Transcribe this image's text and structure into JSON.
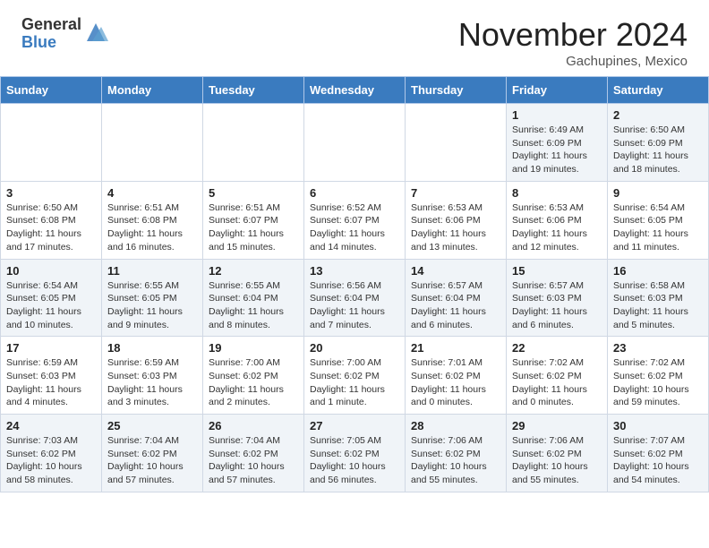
{
  "header": {
    "logo_general": "General",
    "logo_blue": "Blue",
    "month_title": "November 2024",
    "location": "Gachupines, Mexico"
  },
  "calendar": {
    "days_of_week": [
      "Sunday",
      "Monday",
      "Tuesday",
      "Wednesday",
      "Thursday",
      "Friday",
      "Saturday"
    ],
    "weeks": [
      [
        {
          "day": "",
          "info": ""
        },
        {
          "day": "",
          "info": ""
        },
        {
          "day": "",
          "info": ""
        },
        {
          "day": "",
          "info": ""
        },
        {
          "day": "",
          "info": ""
        },
        {
          "day": "1",
          "info": "Sunrise: 6:49 AM\nSunset: 6:09 PM\nDaylight: 11 hours and 19 minutes."
        },
        {
          "day": "2",
          "info": "Sunrise: 6:50 AM\nSunset: 6:09 PM\nDaylight: 11 hours and 18 minutes."
        }
      ],
      [
        {
          "day": "3",
          "info": "Sunrise: 6:50 AM\nSunset: 6:08 PM\nDaylight: 11 hours and 17 minutes."
        },
        {
          "day": "4",
          "info": "Sunrise: 6:51 AM\nSunset: 6:08 PM\nDaylight: 11 hours and 16 minutes."
        },
        {
          "day": "5",
          "info": "Sunrise: 6:51 AM\nSunset: 6:07 PM\nDaylight: 11 hours and 15 minutes."
        },
        {
          "day": "6",
          "info": "Sunrise: 6:52 AM\nSunset: 6:07 PM\nDaylight: 11 hours and 14 minutes."
        },
        {
          "day": "7",
          "info": "Sunrise: 6:53 AM\nSunset: 6:06 PM\nDaylight: 11 hours and 13 minutes."
        },
        {
          "day": "8",
          "info": "Sunrise: 6:53 AM\nSunset: 6:06 PM\nDaylight: 11 hours and 12 minutes."
        },
        {
          "day": "9",
          "info": "Sunrise: 6:54 AM\nSunset: 6:05 PM\nDaylight: 11 hours and 11 minutes."
        }
      ],
      [
        {
          "day": "10",
          "info": "Sunrise: 6:54 AM\nSunset: 6:05 PM\nDaylight: 11 hours and 10 minutes."
        },
        {
          "day": "11",
          "info": "Sunrise: 6:55 AM\nSunset: 6:05 PM\nDaylight: 11 hours and 9 minutes."
        },
        {
          "day": "12",
          "info": "Sunrise: 6:55 AM\nSunset: 6:04 PM\nDaylight: 11 hours and 8 minutes."
        },
        {
          "day": "13",
          "info": "Sunrise: 6:56 AM\nSunset: 6:04 PM\nDaylight: 11 hours and 7 minutes."
        },
        {
          "day": "14",
          "info": "Sunrise: 6:57 AM\nSunset: 6:04 PM\nDaylight: 11 hours and 6 minutes."
        },
        {
          "day": "15",
          "info": "Sunrise: 6:57 AM\nSunset: 6:03 PM\nDaylight: 11 hours and 6 minutes."
        },
        {
          "day": "16",
          "info": "Sunrise: 6:58 AM\nSunset: 6:03 PM\nDaylight: 11 hours and 5 minutes."
        }
      ],
      [
        {
          "day": "17",
          "info": "Sunrise: 6:59 AM\nSunset: 6:03 PM\nDaylight: 11 hours and 4 minutes."
        },
        {
          "day": "18",
          "info": "Sunrise: 6:59 AM\nSunset: 6:03 PM\nDaylight: 11 hours and 3 minutes."
        },
        {
          "day": "19",
          "info": "Sunrise: 7:00 AM\nSunset: 6:02 PM\nDaylight: 11 hours and 2 minutes."
        },
        {
          "day": "20",
          "info": "Sunrise: 7:00 AM\nSunset: 6:02 PM\nDaylight: 11 hours and 1 minute."
        },
        {
          "day": "21",
          "info": "Sunrise: 7:01 AM\nSunset: 6:02 PM\nDaylight: 11 hours and 0 minutes."
        },
        {
          "day": "22",
          "info": "Sunrise: 7:02 AM\nSunset: 6:02 PM\nDaylight: 11 hours and 0 minutes."
        },
        {
          "day": "23",
          "info": "Sunrise: 7:02 AM\nSunset: 6:02 PM\nDaylight: 10 hours and 59 minutes."
        }
      ],
      [
        {
          "day": "24",
          "info": "Sunrise: 7:03 AM\nSunset: 6:02 PM\nDaylight: 10 hours and 58 minutes."
        },
        {
          "day": "25",
          "info": "Sunrise: 7:04 AM\nSunset: 6:02 PM\nDaylight: 10 hours and 57 minutes."
        },
        {
          "day": "26",
          "info": "Sunrise: 7:04 AM\nSunset: 6:02 PM\nDaylight: 10 hours and 57 minutes."
        },
        {
          "day": "27",
          "info": "Sunrise: 7:05 AM\nSunset: 6:02 PM\nDaylight: 10 hours and 56 minutes."
        },
        {
          "day": "28",
          "info": "Sunrise: 7:06 AM\nSunset: 6:02 PM\nDaylight: 10 hours and 55 minutes."
        },
        {
          "day": "29",
          "info": "Sunrise: 7:06 AM\nSunset: 6:02 PM\nDaylight: 10 hours and 55 minutes."
        },
        {
          "day": "30",
          "info": "Sunrise: 7:07 AM\nSunset: 6:02 PM\nDaylight: 10 hours and 54 minutes."
        }
      ]
    ]
  }
}
